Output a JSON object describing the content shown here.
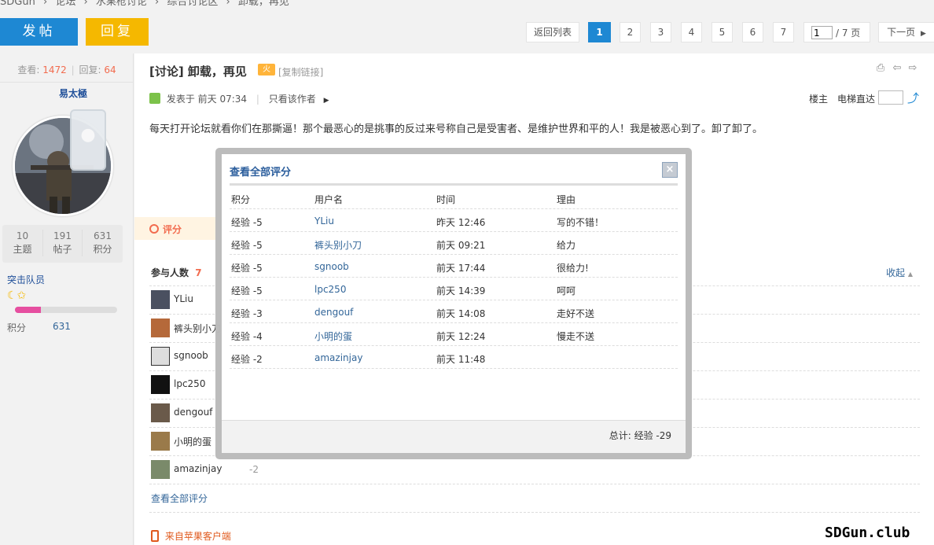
{
  "breadcrumb": [
    "SDGun",
    "›",
    "论坛",
    "›",
    "水果枪讨论",
    "›",
    "综合讨论区",
    "›",
    "卸载，再见"
  ],
  "toolbar": {
    "post_label": "发帖",
    "reply_label": "回复"
  },
  "pager": {
    "back_label": "返回列表",
    "pages": [
      "1",
      "2",
      "3",
      "4",
      "5",
      "6",
      "7"
    ],
    "current": "1",
    "input_value": "1",
    "total_label": "/ 7 页",
    "next_label": "下一页"
  },
  "user": {
    "views_label": "查看:",
    "views": "1472",
    "sep": "|",
    "replies_label": "回复:",
    "replies": "64",
    "name": "易太極",
    "stats": [
      {
        "value": "10",
        "label": "主题"
      },
      {
        "value": "191",
        "label": "帖子"
      },
      {
        "value": "631",
        "label": "积分"
      }
    ],
    "group": "突击队员",
    "medals": "☾✩",
    "level_progress": 0.25,
    "points_label": "积分",
    "points_value": "631"
  },
  "post": {
    "title": "[讨论] 卸载，再见",
    "badge": "火",
    "copy_link": "[复制链接]",
    "posted_label": "发表于 前天 07:34",
    "divider": "|",
    "only_author": "只看该作者",
    "floor_owner": "楼主",
    "elevator": "电梯直达",
    "body": "每天打开论坛就看你们在那撕逼！那个最恶心的是挑事的反过来号称自己是受害者、是维护世界和平的人！我是被恶心到了。卸了卸了。"
  },
  "rating": {
    "label": "评分",
    "participants_label": "参与人数",
    "participants_count": "7",
    "collapse_label": "收起",
    "participants": [
      {
        "name": "YLiu"
      },
      {
        "name": "裤头别小刀"
      },
      {
        "name": "sgnoob"
      },
      {
        "name": "lpc250"
      },
      {
        "name": "dengouf"
      },
      {
        "name": "小明的蛋"
      },
      {
        "name": "amazinjay"
      }
    ],
    "last_score": "-2",
    "view_all": "查看全部评分",
    "client": "来自苹果客户端"
  },
  "modal": {
    "title": "查看全部评分",
    "close": "×",
    "headers": [
      "积分",
      "用户名",
      "时间",
      "理由"
    ],
    "rows": [
      {
        "score": "经验 -5",
        "user": "YLiu",
        "time": "昨天 12:46",
        "reason": "写的不错！"
      },
      {
        "score": "经验 -5",
        "user": "裤头别小刀",
        "time": "前天 09:21",
        "reason": "给力"
      },
      {
        "score": "经验 -5",
        "user": "sgnoob",
        "time": "前天 17:44",
        "reason": "很给力!"
      },
      {
        "score": "经验 -5",
        "user": "lpc250",
        "time": "前天 14:39",
        "reason": "呵呵"
      },
      {
        "score": "经验 -3",
        "user": "dengouf",
        "time": "前天 14:08",
        "reason": "走好不送"
      },
      {
        "score": "经验 -4",
        "user": "小明的蛋",
        "time": "前天 12:24",
        "reason": "慢走不送"
      },
      {
        "score": "经验 -2",
        "user": "amazinjay",
        "time": "前天 11:48",
        "reason": ""
      }
    ],
    "total": "总计: 经验 -29"
  },
  "watermark": "SDGun.club",
  "colors": {
    "primary": "#1e88d3",
    "reply": "#f5b800",
    "accent": "#f26c4f",
    "link": "#336699"
  }
}
